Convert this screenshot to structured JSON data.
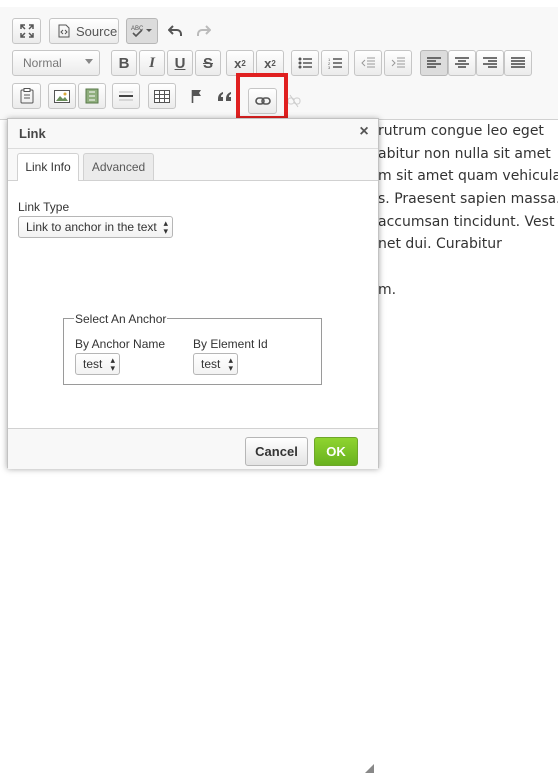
{
  "toolbar": {
    "source_label": "Source",
    "format_label": "Normal",
    "row1": [
      "maximize-icon",
      "source-button",
      "spellcheck-icon",
      "undo-icon",
      "redo-icon"
    ],
    "row2": [
      "bold-icon",
      "italic-icon",
      "underline-icon",
      "strike-icon",
      "subscript-icon",
      "superscript-icon",
      "bulleted-list-icon",
      "numbered-list-icon",
      "outdent-icon",
      "indent-icon",
      "align-left-icon",
      "align-center-icon",
      "align-right-icon",
      "justify-icon"
    ],
    "row3": [
      "paste-text-icon",
      "image-icon",
      "flash-icon",
      "horizontal-rule-icon",
      "table-icon",
      "anchor-icon",
      "blockquote-icon",
      "link-icon",
      "unlink-icon"
    ],
    "highlight_color": "#e02020"
  },
  "content": {
    "lines": [
      "rutrum congue leo eget",
      "abitur non nulla sit amet",
      "m sit amet quam vehicula",
      "s. Praesent sapien massa.",
      "accumsan tincidunt. Vest",
      "net dui. Curabitur",
      "",
      "m."
    ]
  },
  "dialog": {
    "title": "Link",
    "close": "×",
    "tabs": [
      "Link Info",
      "Advanced"
    ],
    "link_type_label": "Link Type",
    "link_type_value": "Link to anchor in the text",
    "anchor_legend": "Select An Anchor",
    "by_name_label": "By Anchor Name",
    "by_name_value": "test",
    "by_id_label": "By Element Id",
    "by_id_value": "test",
    "cancel_label": "Cancel",
    "ok_label": "OK",
    "ok_color": "#7cc428"
  }
}
